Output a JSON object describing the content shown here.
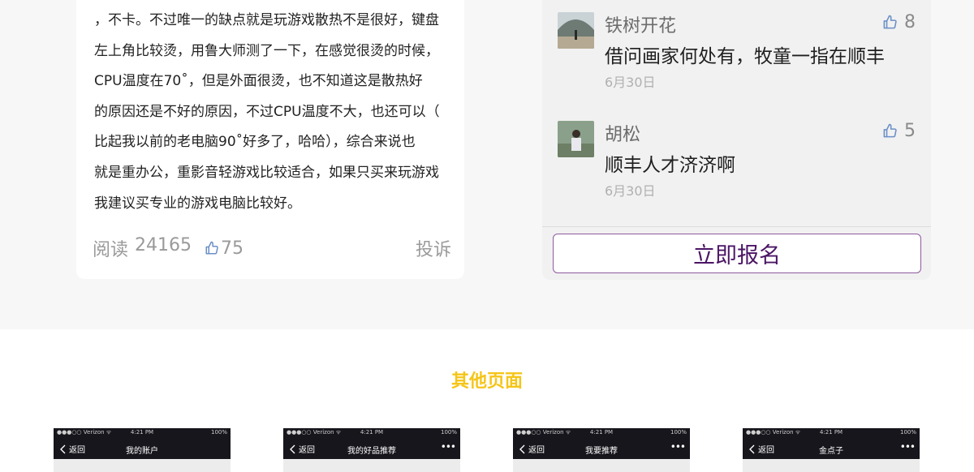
{
  "review": {
    "lines": [
      "，不卡。不过唯一的缺点就是玩游戏散热不是很好，键盘",
      "左上角比较烫，用鲁大师测了一下，在感觉很烫的时候，",
      "CPU温度在70˚，但是外面很烫，也不知道这是散热好",
      "的原因还是不好的原因，不过CPU温度不大，也还可以（",
      "比起我以前的老电脑90˚好多了，哈哈），综合来说也",
      "就是重办公，重影音轻游戏比较适合，如果只买来玩游戏",
      "我建议买专业的游戏电脑比较好。"
    ],
    "read_label": "阅读",
    "read_count": "24165",
    "likes": "75",
    "report_label": "投诉"
  },
  "comments": [
    {
      "name": "铁树开花",
      "text": "借问画家何处有，牧童一指在顺丰",
      "date": "6月30日",
      "likes": "8"
    },
    {
      "name": "胡松",
      "text": "顺丰人才济济啊",
      "date": "6月30日",
      "likes": "5"
    }
  ],
  "signup_button": "立即报名",
  "other_pages": {
    "title": "其他页面",
    "screens": [
      {
        "carrier": "●●●○○ Verizon ᯤ",
        "time": "4:21 PM",
        "battery": "100%",
        "back": "返回",
        "title": "我的账户",
        "more": ""
      },
      {
        "carrier": "●●●○○ Verizon ᯤ",
        "time": "4:21 PM",
        "battery": "100%",
        "back": "返回",
        "title": "我的好品推荐",
        "more": "•••"
      },
      {
        "carrier": "●●●○○ Verizon ᯤ",
        "time": "4:21 PM",
        "battery": "100%",
        "back": "返回",
        "title": "我要推荐",
        "more": "•••"
      },
      {
        "carrier": "●●●○○ Verizon ᯤ",
        "time": "4:21 PM",
        "battery": "100%",
        "back": "返回",
        "title": "金点子",
        "more": "•••"
      }
    ]
  },
  "colors": {
    "accent_yellow": "#f5c518",
    "button_text": "#4b1565",
    "button_border": "#8e5a9e",
    "like_icon": "#6b8fc7"
  }
}
